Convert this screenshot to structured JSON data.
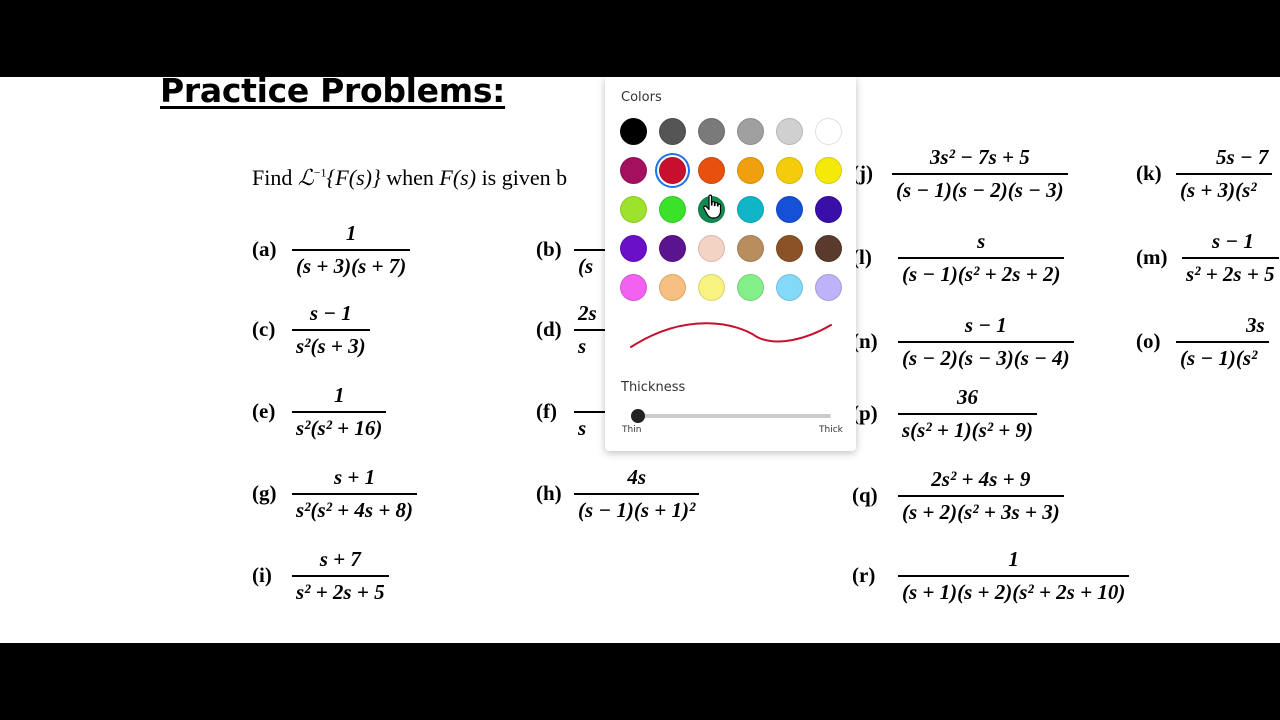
{
  "document": {
    "title": "Practice Problems:",
    "instruction": {
      "find": "Find ",
      "op": "ℒ",
      "sup": "−1",
      "arg": "{F(s)}",
      "mid": " when ",
      "fs": "F(s)",
      "end": " is given b"
    },
    "problems": {
      "a": {
        "label": "(a)",
        "num": "1",
        "den": "(s + 3)(s + 7)"
      },
      "b": {
        "label": "(b)",
        "num": "",
        "den": "(s"
      },
      "c": {
        "label": "(c)",
        "num": "s − 1",
        "den": "s²(s + 3)"
      },
      "d": {
        "label": "(d)",
        "num": "2s",
        "den": "s"
      },
      "e": {
        "label": "(e)",
        "num": "1",
        "den": "s²(s² + 16)"
      },
      "f": {
        "label": "(f)",
        "num": "",
        "den": "s"
      },
      "g": {
        "label": "(g)",
        "num": "s + 1",
        "den": "s²(s² + 4s + 8)"
      },
      "h": {
        "label": "(h)",
        "num": "4s",
        "den": "(s − 1)(s + 1)²"
      },
      "i": {
        "label": "(i)",
        "num": "s + 7",
        "den": "s² + 2s + 5"
      },
      "j": {
        "label": "(j)",
        "num": "3s² − 7s + 5",
        "den": "(s − 1)(s − 2)(s − 3)"
      },
      "k": {
        "label": "(k)",
        "num": "5s − 7",
        "den": "(s + 3)(s²"
      },
      "l": {
        "label": "(l)",
        "num": "s",
        "den": "(s − 1)(s² + 2s + 2)"
      },
      "m": {
        "label": "(m)",
        "num": "s − 1",
        "den": "s² + 2s + 5"
      },
      "n": {
        "label": "(n)",
        "num": "s − 1",
        "den": "(s − 2)(s − 3)(s − 4)"
      },
      "o": {
        "label": "(o)",
        "num": "3s",
        "den": "(s − 1)(s²"
      },
      "p": {
        "label": "(p)",
        "num": "36",
        "den": "s(s² + 1)(s² + 9)"
      },
      "q": {
        "label": "(q)",
        "num": "2s² + 4s + 9",
        "den": "(s + 2)(s² + 3s + 3)"
      },
      "r": {
        "label": "(r)",
        "num": "1",
        "den": "(s + 1)(s + 2)(s² + 2s + 10)"
      }
    }
  },
  "picker": {
    "colors_label": "Colors",
    "thickness_label": "Thickness",
    "thin_label": "Thin",
    "thick_label": "Thick",
    "selected_color": "#c8102e",
    "swatches": [
      "#000000",
      "#555555",
      "#7a7a7a",
      "#a0a0a0",
      "#d0d0d0",
      "#ffffff",
      "#a3115e",
      "#c8102e",
      "#e8500e",
      "#f0a00f",
      "#f5cc0a",
      "#f5e90a",
      "#9de22d",
      "#3ae22a",
      "#118b50",
      "#10b5c8",
      "#1650d8",
      "#3a0ea8",
      "#6a10c8",
      "#5a1490",
      "#f2d3c4",
      "#b88e5e",
      "#8a5226",
      "#5a3a2c",
      "#f262f0",
      "#f8c080",
      "#f8f280",
      "#84ee88",
      "#84d8f8",
      "#beb2f8"
    ]
  }
}
